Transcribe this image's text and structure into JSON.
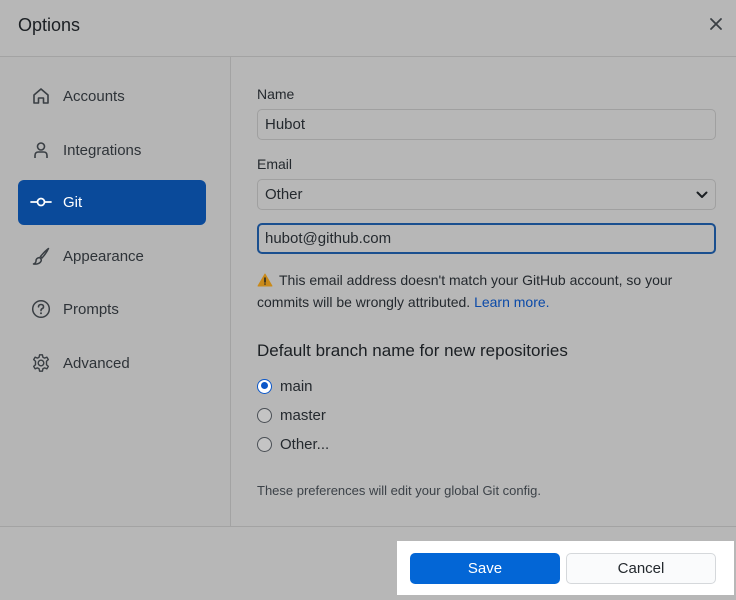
{
  "dialog": {
    "title": "Options",
    "close_icon": "close-icon"
  },
  "sidebar": {
    "items": [
      {
        "label": "Accounts",
        "icon": "home-icon",
        "active": false
      },
      {
        "label": "Integrations",
        "icon": "person-icon",
        "active": false
      },
      {
        "label": "Git",
        "icon": "git-commit-icon",
        "active": true
      },
      {
        "label": "Appearance",
        "icon": "paintbrush-icon",
        "active": false
      },
      {
        "label": "Prompts",
        "icon": "question-icon",
        "active": false
      },
      {
        "label": "Advanced",
        "icon": "gear-icon",
        "active": false
      }
    ]
  },
  "git": {
    "name_label": "Name",
    "name_value": "Hubot",
    "email_label": "Email",
    "email_select_value": "Other",
    "email_value": "hubot@github.com",
    "warning_text": "This email address doesn't match your GitHub account, so your commits will be wrongly attributed.",
    "warning_link": "Learn more.",
    "branch_title": "Default branch name for new repositories",
    "branch_options": [
      {
        "label": "main",
        "checked": true
      },
      {
        "label": "master",
        "checked": false
      },
      {
        "label": "Other...",
        "checked": false
      }
    ],
    "note": "These preferences will edit your global Git config."
  },
  "footer": {
    "save_label": "Save",
    "cancel_label": "Cancel"
  },
  "colors": {
    "accent": "#0366d6",
    "active_nav": "#0a4a9a",
    "link": "#0b4aa8",
    "warning": "#d29922"
  }
}
